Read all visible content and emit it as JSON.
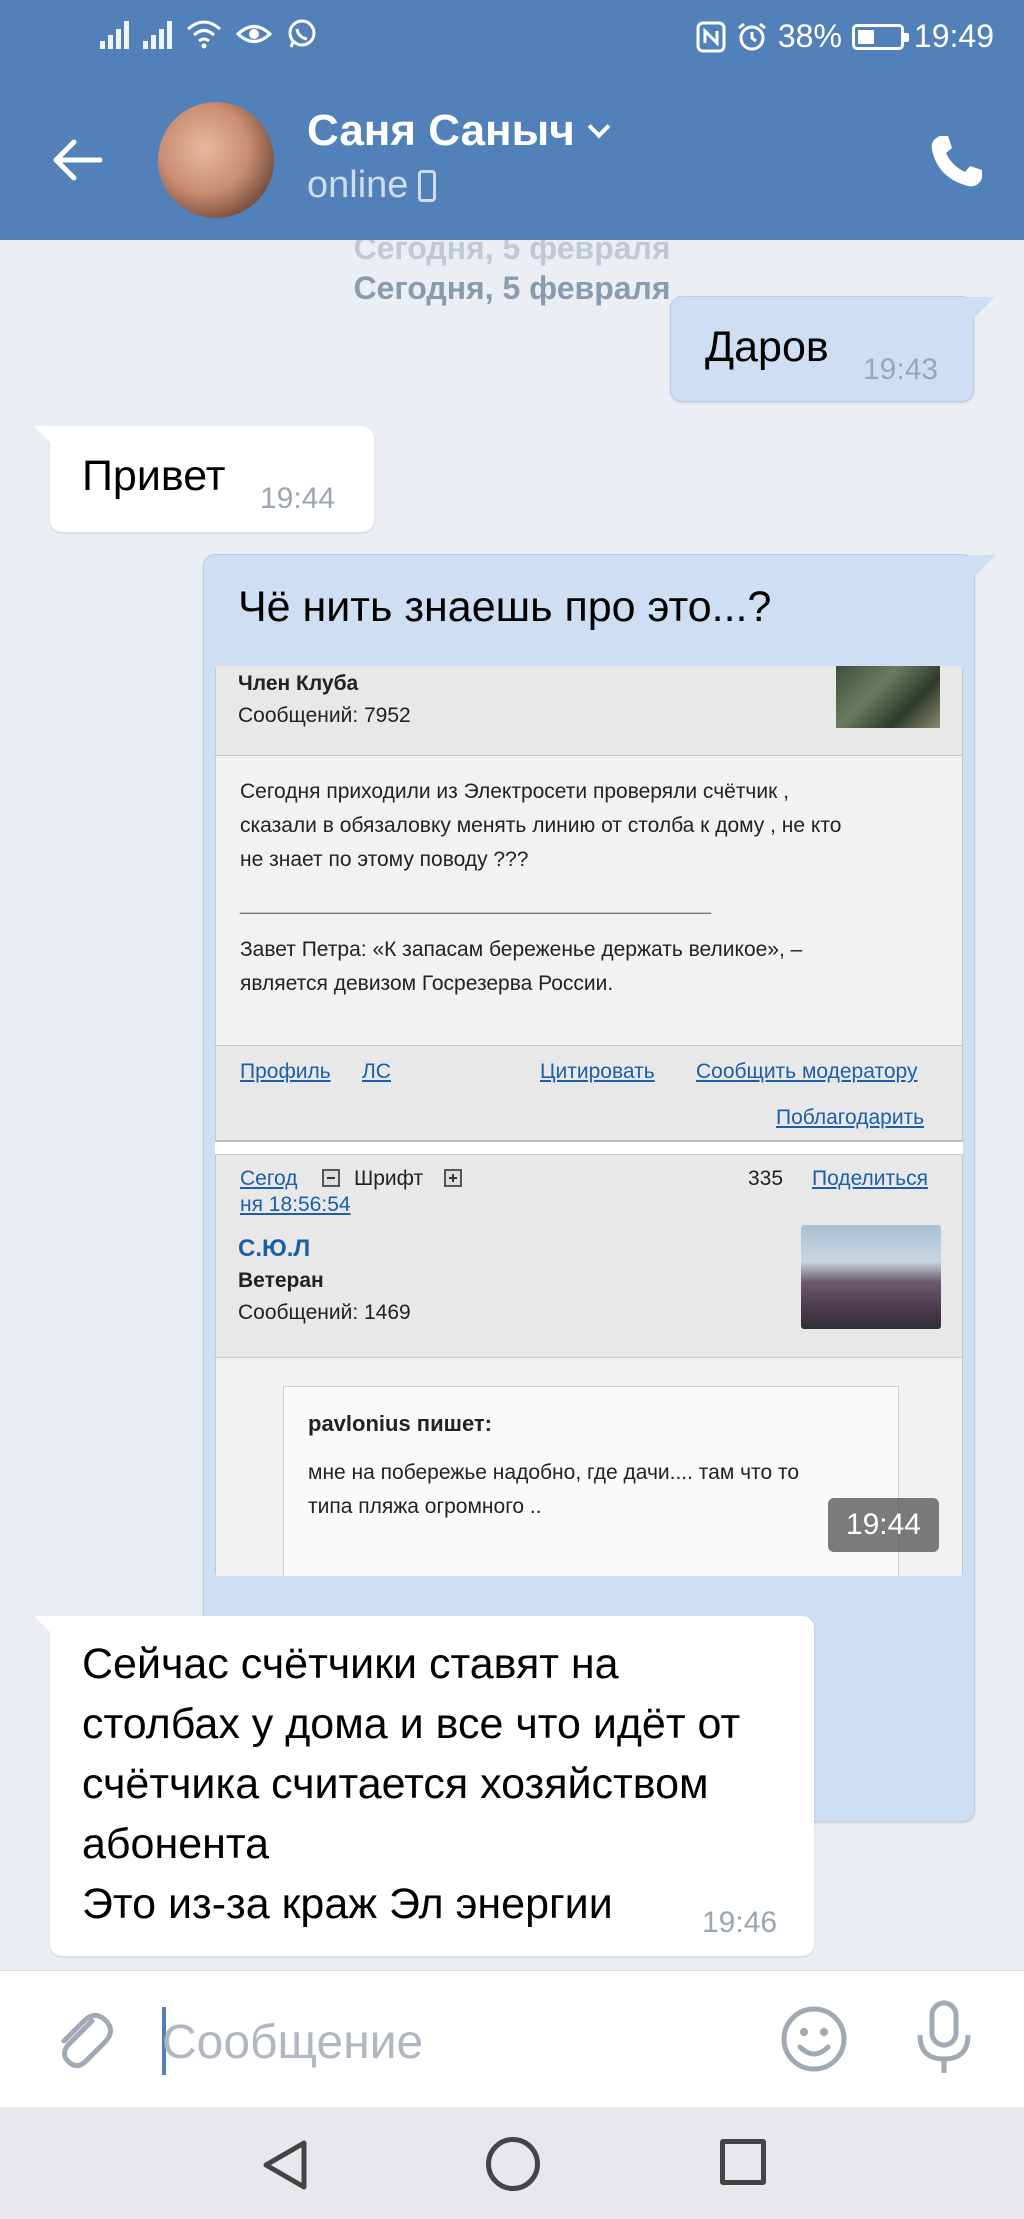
{
  "status_bar": {
    "battery": "38%",
    "time": "19:49"
  },
  "header": {
    "contact_name": "Саня Саныч",
    "status": "online"
  },
  "chat": {
    "date_ghost": "Сегодня, 5 февраля",
    "date": "Сегодня, 5 февраля",
    "messages": [
      {
        "text": "Даров",
        "time": "19:43"
      },
      {
        "text": "Привет",
        "time": "19:44"
      },
      {
        "text": "Чё нить знаешь про это...?",
        "time": "19:44"
      },
      {
        "text": "Сейчас счётчики ставят на столбах у дома и все что идёт от счётчика считается хозяйством абонента\nЭто из-за краж Эл энергии",
        "time": "19:46"
      }
    ]
  },
  "forum_image": {
    "post1": {
      "rank": "Член Клуба",
      "messages_count": "Сообщений: 7952",
      "body_line1": "Сегодня приходили из Электросети проверяли счётчик ,",
      "body_line2": "сказали в обязаловку менять линию от столба к дому , не кто",
      "body_line3": "не знает по этому поводу ???",
      "separator": "____________________________________________",
      "sig_line1": "Завет Петра: «К запасам береженье держать великое», –",
      "sig_line2": "является девизом Госрезерва России.",
      "link_profile": "Профиль",
      "link_pm": "ЛС",
      "link_quote": "Цитировать",
      "link_report": "Сообщить модератору",
      "link_thanks": "Поблагодарить"
    },
    "post2": {
      "date_part1": "Сегод",
      "date_part2": "ня 18:56:54",
      "font_label": "Шрифт",
      "number": "335",
      "share": "Поделиться",
      "author": "С.Ю.Л",
      "rank": "Ветеран",
      "messages_count": "Сообщений: 1469",
      "quote_author": "pavlonius пишет:",
      "quote_line1": "мне на побережье надобно, где дачи.... там что то",
      "quote_line2": "типа пляжа огромного .."
    }
  },
  "composer": {
    "placeholder": "Сообщение"
  },
  "colors": {
    "header": "#5181b8",
    "outgoing_bubble": "#cfdff3",
    "incoming_bubble": "#ffffff",
    "background": "#ebeef3"
  }
}
